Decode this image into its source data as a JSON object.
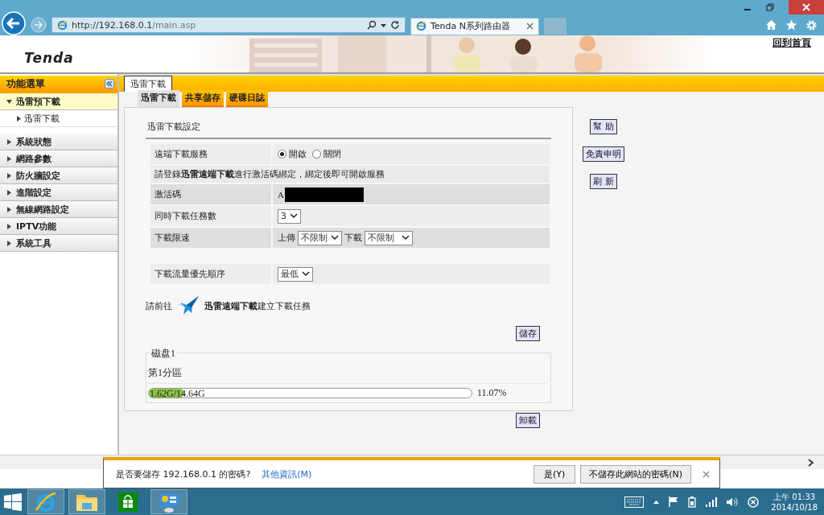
{
  "browser": {
    "url_host": "http://192.168.0.1",
    "url_path": "/main.asp",
    "tab_title": "Tenda N系列路由器"
  },
  "header": {
    "logo": "Tenda",
    "home_link": "回到首頁"
  },
  "sidebar": {
    "title": "功能選單",
    "groups": [
      {
        "label": "迅雷預下載",
        "expanded": true,
        "selected": true,
        "children": [
          {
            "label": "迅雷下載"
          }
        ]
      },
      {
        "label": "系統狀態",
        "expanded": false,
        "selected": false
      },
      {
        "label": "網路參數",
        "expanded": false,
        "selected": false
      },
      {
        "label": "防火牆設定",
        "expanded": false,
        "selected": false
      },
      {
        "label": "進階設定",
        "expanded": false,
        "selected": false
      },
      {
        "label": "無線網路設定",
        "expanded": false,
        "selected": false
      },
      {
        "label": "IPTV功能",
        "expanded": false,
        "selected": false
      },
      {
        "label": "系統工具",
        "expanded": false,
        "selected": false
      }
    ]
  },
  "page_tab": "迅雷下載",
  "subtabs": [
    {
      "label": "迅雷下載",
      "selected": true
    },
    {
      "label": "共享儲存",
      "selected": false
    },
    {
      "label": "硬碟日誌",
      "selected": false
    }
  ],
  "section_title": "迅雷下載設定",
  "rows": [
    {
      "kind": "radio",
      "label": "遠端下載服務",
      "options": [
        {
          "label": "開啟",
          "selected": true
        },
        {
          "label": "關閉",
          "selected": false
        }
      ]
    },
    {
      "kind": "note",
      "text": "請登錄**迅雷遠端下載**進行激活碼綁定，綁定後即可開啟服務"
    },
    {
      "kind": "code",
      "label": "激活碼",
      "value": "A"
    },
    {
      "kind": "select",
      "label": "同時下載任務數",
      "value": "3"
    },
    {
      "kind": "speed",
      "label": "下載限速",
      "upload_label": "上傳",
      "upload": "不限制",
      "download_label": "下載",
      "download": "不限制"
    }
  ],
  "priority_rows": [
    {
      "kind": "select",
      "label": "下載流量優先順序",
      "value": "最低"
    }
  ],
  "goto_prefix": "請前往",
  "goto_text": "**迅雷遠端下載**建立下載任務",
  "save_button": "儲存",
  "disk": {
    "legend": "磁盘1",
    "partition": "第1分區",
    "usage": "1.62G/14.64G",
    "level": 0.1107,
    "percent": "11.07%"
  },
  "unmount_button": "卸載",
  "side_buttons": [
    "幫 助",
    "免責申明",
    "刷 新"
  ],
  "password_bar": {
    "message": "是否要儲存 192.168.0.1 的密碼?",
    "link": "其他資訊(M)",
    "buttons": [
      "是(Y)",
      "不儲存此網站的密碼(N)"
    ]
  },
  "taskbar": {
    "apps": [
      {
        "kind": "ie",
        "running": true
      },
      {
        "kind": "explorer",
        "running": true
      },
      {
        "kind": "store",
        "running": false
      },
      {
        "kind": "control",
        "running": true
      }
    ],
    "time": "上午 01:33",
    "date": "2014/10/18"
  }
}
